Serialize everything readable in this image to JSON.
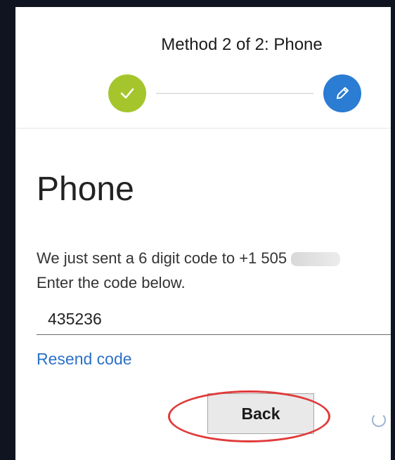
{
  "header": {
    "method_title": "Method 2 of 2: Phone"
  },
  "main": {
    "title": "Phone",
    "message_line1": "We just sent a 6 digit code to +1 505",
    "message_line2": "Enter the code below.",
    "code_value": "435236",
    "resend_label": "Resend code",
    "back_label": "Back"
  },
  "colors": {
    "step_done": "#a4c62c",
    "step_current": "#2b7cd3",
    "link": "#2b71c7",
    "annotation": "#e03a3a"
  },
  "icons": {
    "step_done": "check-icon",
    "step_current": "pencil-icon"
  }
}
